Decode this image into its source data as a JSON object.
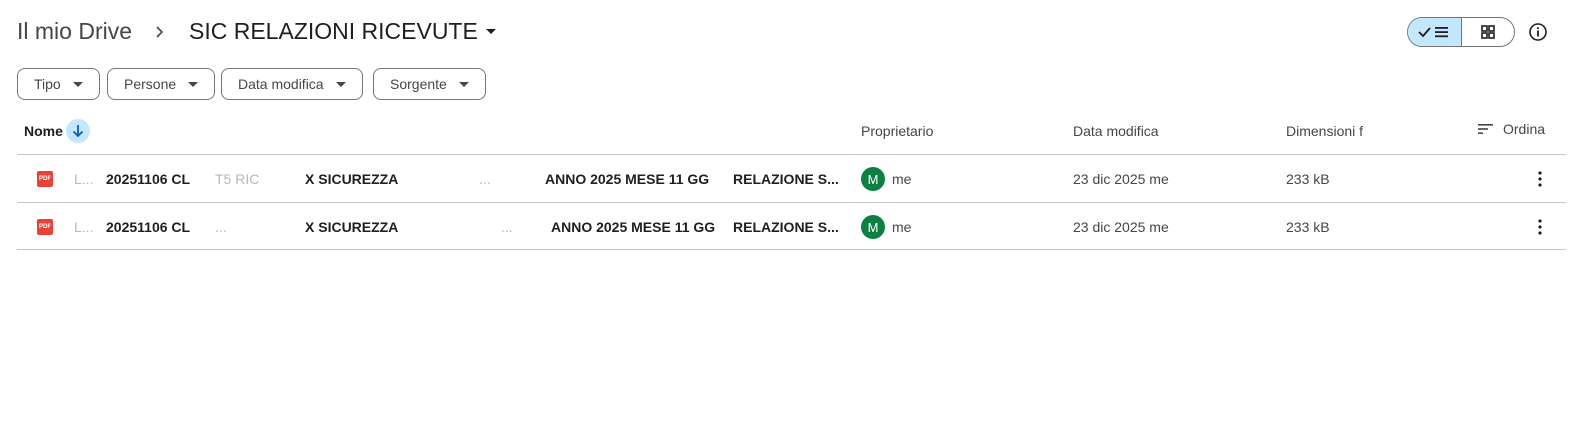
{
  "breadcrumb": {
    "root": "Il mio Drive",
    "current": "SIC RELAZIONI RICEVUTE"
  },
  "view_toggle": {
    "list_icon": "check-list-icon",
    "grid_icon": "grid-icon",
    "active": "list"
  },
  "info_icon": "info-icon",
  "filters": [
    {
      "label": "Tipo"
    },
    {
      "label": "Persone"
    },
    {
      "label": "Data modifica"
    },
    {
      "label": "Sorgente"
    }
  ],
  "table": {
    "columns": {
      "name": "Nome",
      "owner": "Proprietario",
      "modified": "Data modifica",
      "size": "Dimensioni f"
    },
    "sort_label": "Ordina",
    "rows": [
      {
        "icon_text": "PDF",
        "name_parts": [
          "L...",
          "20251106 CL",
          "T5 RIC",
          "X SICUREZZA",
          "...",
          "ANNO 2025 MESE 11 GG",
          "RELAZIONE S..."
        ],
        "owner_initial": "M",
        "owner": "me",
        "modified": "23 dic 2025 me",
        "size": "233 kB"
      },
      {
        "icon_text": "PDF",
        "name_parts": [
          "L...",
          "20251106 CL",
          "...",
          "X SICUREZZA",
          "...",
          "ANNO 2025 MESE 11 GG",
          "RELAZIONE S..."
        ],
        "owner_initial": "M",
        "owner": "me",
        "modified": "23 dic 2025 me",
        "size": "233 kB"
      }
    ]
  },
  "colors": {
    "accent": "#c2e7ff",
    "avatar": "#0b8043",
    "pdf": "#ea4335",
    "divider": "#c4c7c5"
  }
}
